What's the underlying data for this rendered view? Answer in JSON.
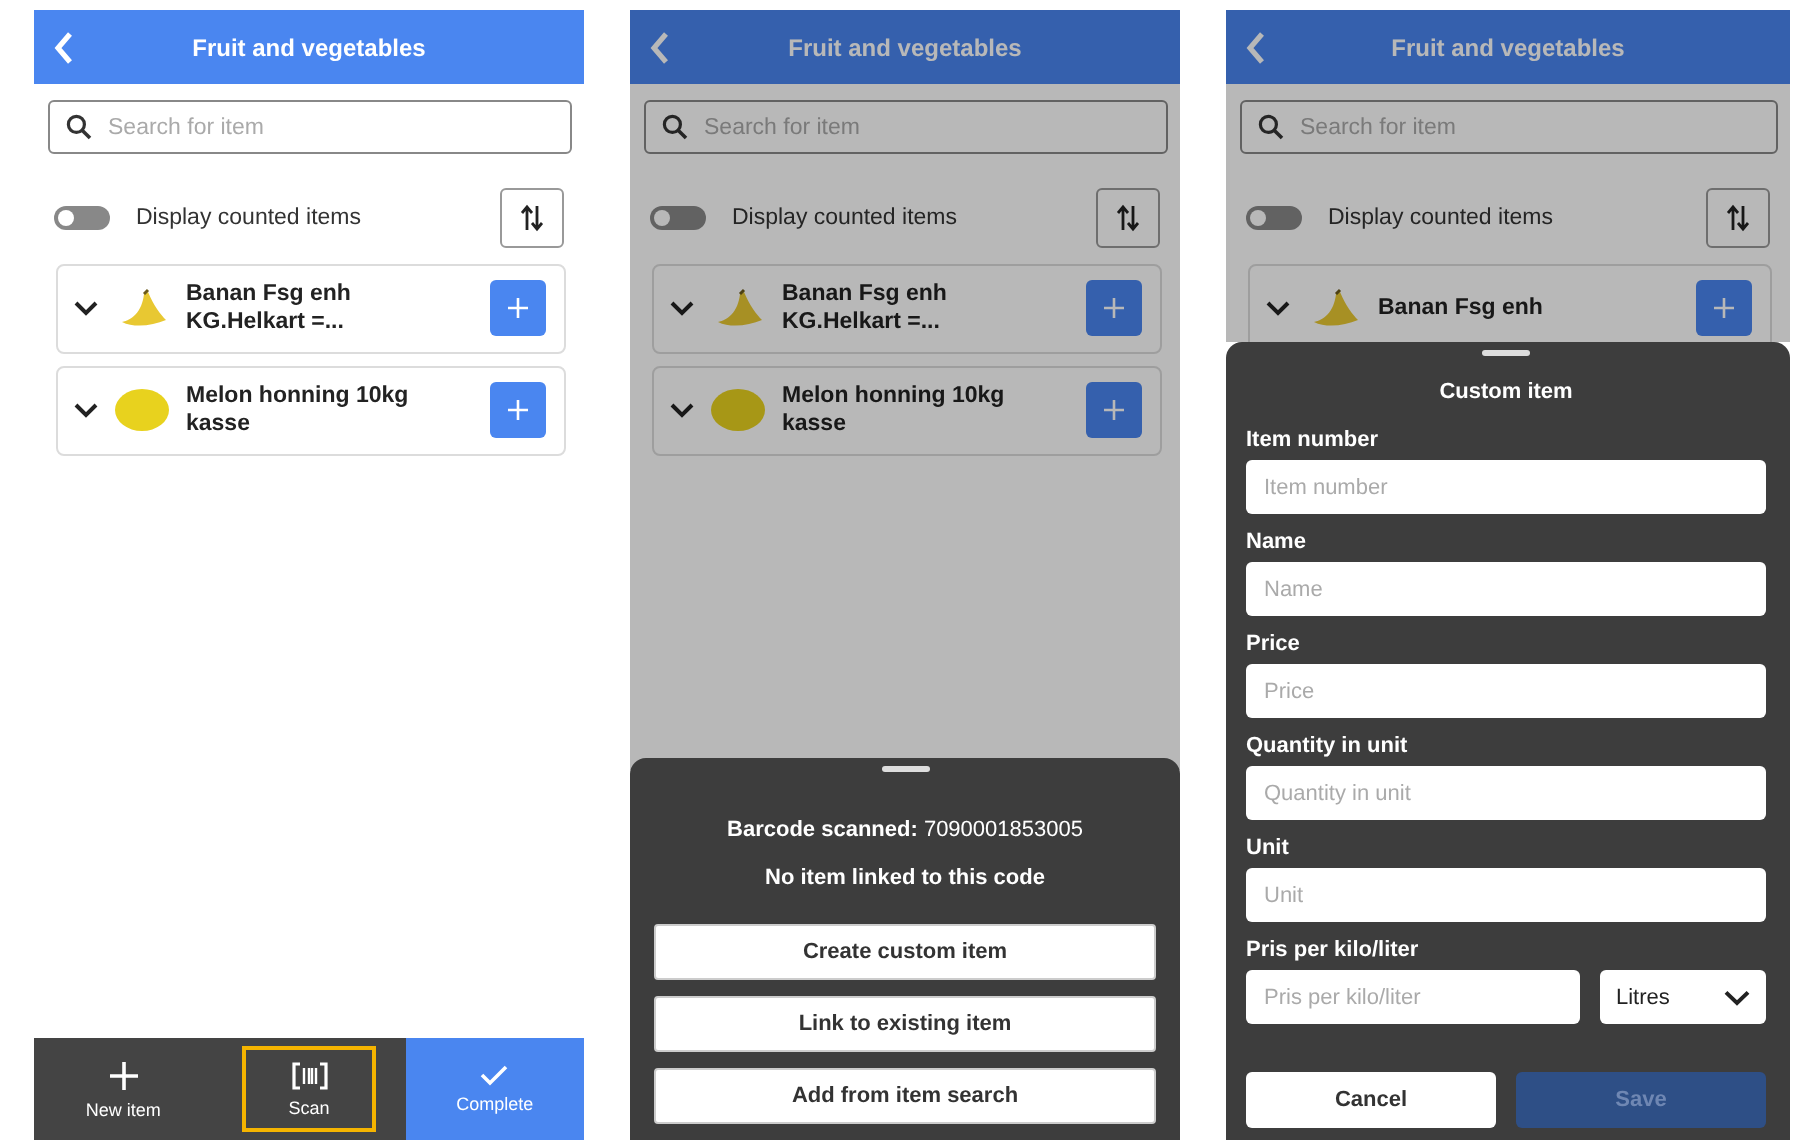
{
  "screens": [
    {
      "header": {
        "title": "Fruit and vegetables"
      },
      "search": {
        "placeholder": "Search for item"
      },
      "toggle": {
        "label": "Display counted items",
        "on": false
      },
      "dimmed": false,
      "items": [
        {
          "name": "Banan Fsg enh KG.Helkart =...",
          "kind": "banana"
        },
        {
          "name": "Melon honning 10kg kasse",
          "kind": "melon"
        }
      ],
      "bottom_bar": [
        {
          "label": "New item",
          "kind": "plus",
          "highlighted": false,
          "primary": false
        },
        {
          "label": "Scan",
          "kind": "scan",
          "highlighted": true,
          "primary": false
        },
        {
          "label": "Complete",
          "kind": "check",
          "highlighted": false,
          "primary": true
        }
      ]
    },
    {
      "header": {
        "title": "Fruit and vegetables"
      },
      "search": {
        "placeholder": "Search for item"
      },
      "toggle": {
        "label": "Display counted items",
        "on": false
      },
      "dimmed": true,
      "items": [
        {
          "name": "Banan Fsg enh KG.Helkart =...",
          "kind": "banana"
        },
        {
          "name": "Melon honning 10kg kasse",
          "kind": "melon"
        }
      ],
      "sheet": {
        "kind": "barcode",
        "barcode": "**Barcode scanned:** 7090001853005",
        "message": "No item linked to this code",
        "buttons": [
          "Create custom item",
          "Link to existing item",
          "Add from item search"
        ]
      }
    },
    {
      "header": {
        "title": "Fruit and vegetables"
      },
      "search": {
        "placeholder": "Search for item"
      },
      "toggle": {
        "label": "Display counted items",
        "on": false
      },
      "dimmed": true,
      "items": [
        {
          "name": "Banan Fsg enh",
          "kind": "banana"
        }
      ],
      "sheet": {
        "kind": "form",
        "title": "Custom item",
        "fields": [
          {
            "label": "Item number",
            "placeholder": "Item number"
          },
          {
            "label": "Name",
            "placeholder": "Name"
          },
          {
            "label": "Price",
            "placeholder": "Price"
          },
          {
            "label": "Quantity in unit",
            "placeholder": "Quantity in unit"
          },
          {
            "label": "Unit",
            "placeholder": "Unit"
          },
          {
            "label": "Pris per kilo/liter",
            "placeholder": "Pris per kilo/liter",
            "unit_select": "Litres"
          }
        ],
        "cancel": "Cancel",
        "save": {
          "label": "Save",
          "disabled": true
        }
      }
    }
  ]
}
